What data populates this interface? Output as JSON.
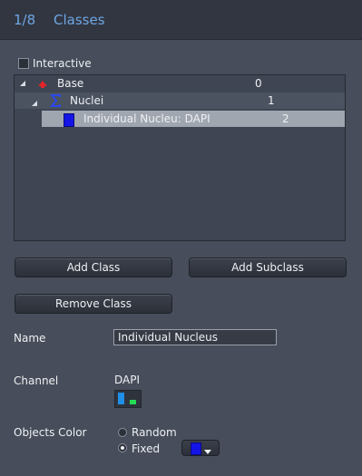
{
  "header": {
    "step": "1/8",
    "title": "Classes"
  },
  "interactive": {
    "label": "Interactive",
    "checked": false
  },
  "tree": {
    "rows": [
      {
        "label": "Base",
        "count": "0",
        "icon": "red-up-arrow-icon",
        "expanded": true
      },
      {
        "label": "Nuclei",
        "count": "1",
        "icon": "sigma-icon",
        "expanded": true
      },
      {
        "label": "Individual Nucleu: DAPI",
        "count": "2",
        "icon": "blue-square-icon",
        "selected": true
      }
    ]
  },
  "buttons": {
    "add_class": "Add Class",
    "add_subclass": "Add Subclass",
    "remove_class": "Remove Class"
  },
  "name": {
    "label": "Name",
    "value": "Individual Nucleus"
  },
  "channel": {
    "label": "Channel",
    "value": "DAPI"
  },
  "objects_color": {
    "label": "Objects Color",
    "random_label": "Random",
    "fixed_label": "Fixed",
    "selected": "Fixed",
    "color": "#1414e6"
  },
  "colors": {
    "accent": "#6fa6e3",
    "base_icon": "#e0262a",
    "nuclei_icon": "#2a49e8",
    "class_color": "#1414e6",
    "channel_blue": "#1f8fe8",
    "channel_green": "#22dd55"
  }
}
